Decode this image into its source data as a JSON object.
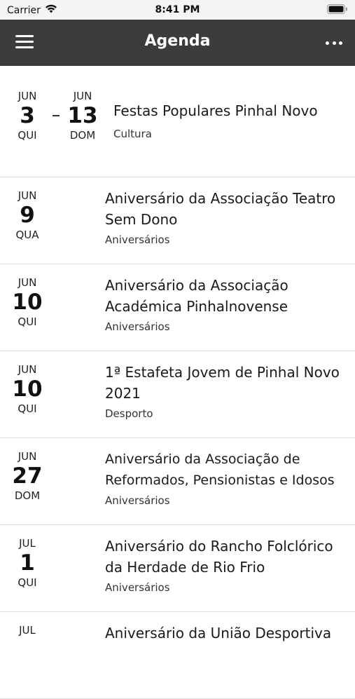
{
  "status": {
    "carrier": "Carrier",
    "time": "8:41 PM"
  },
  "header": {
    "title": "Agenda"
  },
  "events": [
    {
      "start": {
        "month": "JUN",
        "day": "3",
        "weekday": "QUI"
      },
      "end": {
        "month": "JUN",
        "day": "13",
        "weekday": "DOM"
      },
      "title": "Festas Populares Pinhal Novo",
      "category": "Cultura"
    },
    {
      "start": {
        "month": "JUN",
        "day": "9",
        "weekday": "QUA"
      },
      "title_line1": "Aniversário da Associação Teatro",
      "title_line2": "Sem Dono",
      "category": "Aniversários"
    },
    {
      "start": {
        "month": "JUN",
        "day": "10",
        "weekday": "QUI"
      },
      "title_line1": "Aniversário da Associação",
      "title_line2": "Académica Pinhalnovense",
      "category": "Aniversários"
    },
    {
      "start": {
        "month": "JUN",
        "day": "10",
        "weekday": "QUI"
      },
      "title_line1": "1ª Estafeta Jovem de Pinhal Novo",
      "title_line2": "2021",
      "category": "Desporto"
    },
    {
      "start": {
        "month": "JUN",
        "day": "27",
        "weekday": "DOM"
      },
      "title_line1": "Aniversário da Associação de",
      "title_line2": "Reformados, Pensionistas e Idosos",
      "category": "Aniversários"
    },
    {
      "start": {
        "month": "JUL",
        "day": "1",
        "weekday": "QUI"
      },
      "title_line1": "Aniversário do Rancho Folclórico",
      "title_line2": "da Herdade de Rio Frio",
      "category": "Aniversários"
    },
    {
      "start": {
        "month": "JUL"
      },
      "title_line1": "Aniversário da União Desportiva"
    }
  ]
}
